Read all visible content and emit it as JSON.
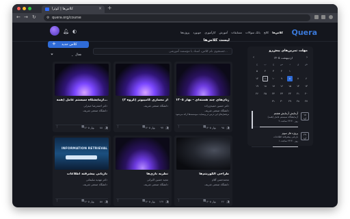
{
  "browser": {
    "tab_title": "کلاس‌ها | کوئرا",
    "new_tab": "+",
    "url": "quera.org/course",
    "tab_close": "×",
    "traffic_colors": [
      "#ff5f57",
      "#febc2e",
      "#28c840"
    ]
  },
  "site": {
    "logo": "Quera",
    "nav": [
      "کلاس‌ها",
      "کالج",
      "بانک سوالات",
      "مسابقات",
      "آموزش",
      "کارآموزی",
      "جوبورد",
      "پروژه‌ها",
      "جامعه"
    ],
    "nav_active_index": 0
  },
  "page": {
    "title": "لیست کلاس‌ها",
    "new_class_label": "کلاس جدید",
    "new_class_icon": "+",
    "search_placeholder": "جستجوی نام کلاس، استاد یا مؤسسه آموزشی...",
    "filter_label": "فعال",
    "filter_icon": "filter-icon"
  },
  "cards": [
    {
      "title": "زبان‌های چند هسته‌ای - بهار ۱۴۰۵",
      "teacher": "دکتر حسین حمیدی‌زاده",
      "org": "دانشگاه صنعتی شریف",
      "extra": "سرفصل‌های این درس در وبسایت موسسه‌ها ارائه می‌شود",
      "members": "۹۵",
      "term": "بهار ۱۴۰۵",
      "image": "glow1"
    },
    {
      "title": "آز معماری کامپیوتر (گروه ۲)",
      "teacher": "",
      "org": "دانشگاه صنعتی شریف",
      "extra": "",
      "members": "۹۷",
      "term": "بهار ۱۴۰۵",
      "image": "glow2"
    },
    {
      "title": "آزمایشگاه سیستم عامل (همه…",
      "teacher": "دکتر احمد‌رضا حیدرلی",
      "org": "دانشگاه صنعتی شریف",
      "extra": "",
      "members": "۸۸",
      "term": "بهار ۱۴۰۵",
      "image": "glow2"
    },
    {
      "title": "طراحی الگوریتم‌ها",
      "teacher": "محمدحسن آقام",
      "org": "دانشگاه صنعتی شریف",
      "extra": "",
      "members": "۴۶",
      "term": "بهار ۱۴۰۵",
      "image": "dark"
    },
    {
      "title": "نظریه بازی‌ها",
      "teacher": "مجید حسین اکبرانی",
      "org": "دانشگاه صنعتی شریف",
      "extra": "",
      "members": "۱۲۷",
      "term": "بهار ۱۴۰۵",
      "image": "glow1"
    },
    {
      "title": "بازیابی پیشرفته اطلاعات",
      "teacher": "دکتر مهدیه سلیمانی",
      "org": "دانشگاه صنعتی شریف",
      "extra": "",
      "members": "۵۸",
      "term": "بهار ۱۴۰۵",
      "image": "ir",
      "image_text": "INFORMATION RETRIEVAL"
    }
  ],
  "sidebar": {
    "title": "مهلت تمرین‌های پیش‌رو",
    "month": "اردیبهشت ۱۴۰۵",
    "prev_arrow": "‹",
    "next_arrow": "›",
    "weekdays": [
      "ش",
      "ی",
      "د",
      "س",
      "چ",
      "پ",
      "ج"
    ],
    "weeks": [
      [
        "",
        "",
        "۱",
        "۲",
        "۳",
        "۴",
        "۵"
      ],
      [
        "۶",
        "۷",
        "۸",
        "۹",
        "۱۰",
        "۱۱",
        "۱۲"
      ],
      [
        "۱۳",
        "۱۴",
        "۱۵",
        "۱۶",
        "۱۷",
        "۱۸",
        "۱۹"
      ],
      [
        "۲۰",
        "۲۱",
        "۲۲",
        "۲۳",
        "۲۴",
        "۲۵",
        "۲۶"
      ],
      [
        "۲۷",
        "۲۸",
        "۲۹",
        "۳۰",
        "۳۱",
        "",
        ""
      ]
    ],
    "selected_day": "۸",
    "marked_day": "۱۱",
    "deadlines": [
      {
        "day": "۱۸",
        "month": "ارد",
        "title": "آزمایش آزمایش هشتم",
        "sub": "آزمایشگاه سیستم عامل (همه)",
        "meta": "۲ روز ۲۳:۴۰ ساعت",
        "progress": 0.85,
        "active": true
      },
      {
        "day": "۲۹",
        "month": "ارد",
        "title": "پروژه فاز سوم",
        "sub": "بازیابی پیشرفته اطلاعات",
        "meta": "۱ روز ۲۳:۴۰ ساعت",
        "progress": 0.55,
        "active": false
      }
    ]
  }
}
